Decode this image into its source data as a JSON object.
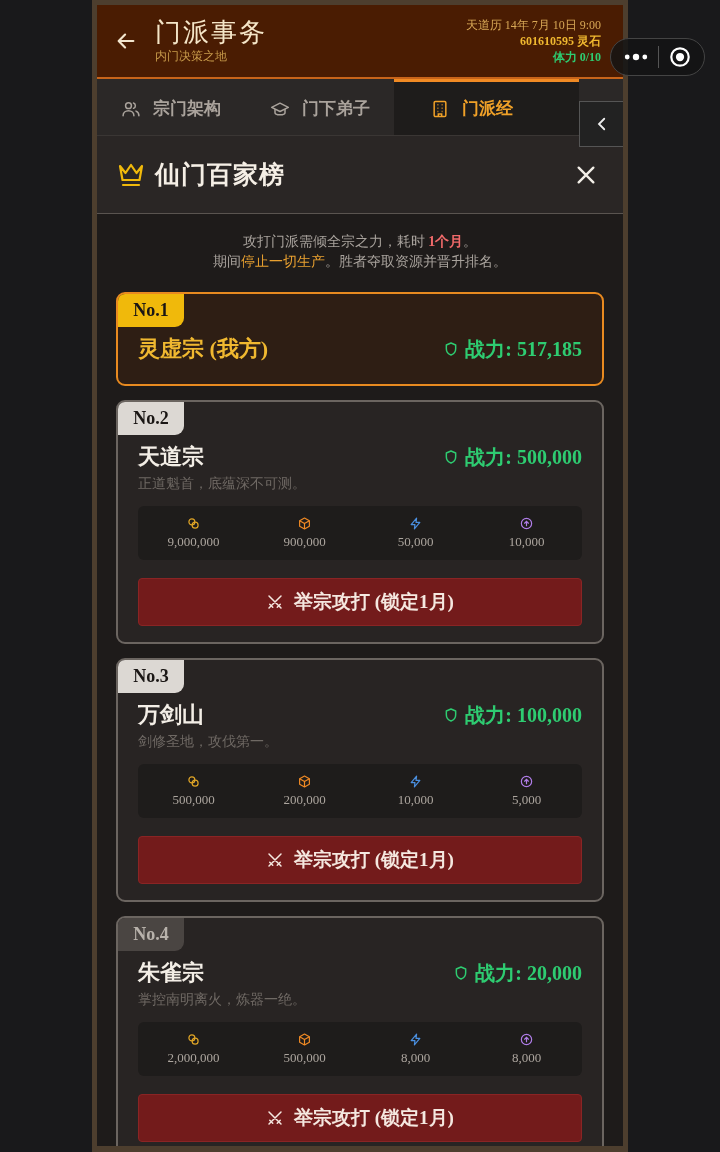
{
  "header": {
    "title": "门派事务",
    "subtitle": "内门决策之地",
    "date": "天道历 14年 7月 10日 9:00",
    "stones": "601610595 灵石",
    "stamina": "体力 0/10"
  },
  "tabs": [
    {
      "label": "宗门架构",
      "selected": false
    },
    {
      "label": "门下弟子",
      "selected": false
    },
    {
      "label": "门派经",
      "selected": true
    }
  ],
  "modal": {
    "title": "仙门百家榜",
    "notice": [
      [
        {
          "text": "攻打门派需倾全宗之力，耗时 "
        },
        {
          "text": "1个月",
          "kind": "danger"
        },
        {
          "text": "。"
        }
      ],
      [
        {
          "text": "期间"
        },
        {
          "text": "停止一切生产",
          "kind": "warn"
        },
        {
          "text": "。胜者夺取资源并晋升排名。"
        }
      ]
    ]
  },
  "sects": [
    {
      "rank": "No.1",
      "color": "#f0b90b",
      "own": true,
      "name": "灵虚宗 (我方)",
      "power": "战力: 517,185"
    },
    {
      "rank": "No.2",
      "color": "#dcd8d3",
      "own": false,
      "name": "天道宗",
      "power": "战力: 500,000",
      "motto": "正道魁首，底蕴深不可测。",
      "resources": [
        {
          "kind": "coins",
          "value": "9,000,000"
        },
        {
          "kind": "box",
          "value": "900,000"
        },
        {
          "kind": "energy",
          "value": "50,000"
        },
        {
          "kind": "upgrade",
          "value": "10,000"
        }
      ],
      "action": "举宗攻打 (锁定1月)"
    },
    {
      "rank": "No.3",
      "color": "#dcd8d3",
      "own": false,
      "name": "万剑山",
      "power": "战力: 100,000",
      "motto": "剑修圣地，攻伐第一。",
      "resources": [
        {
          "kind": "coins",
          "value": "500,000"
        },
        {
          "kind": "box",
          "value": "200,000"
        },
        {
          "kind": "energy",
          "value": "10,000"
        },
        {
          "kind": "upgrade",
          "value": "5,000"
        }
      ],
      "action": "举宗攻打 (锁定1月)"
    },
    {
      "rank": "No.4",
      "color": "#4a4542",
      "own": false,
      "name": "朱雀宗",
      "power": "战力: 20,000",
      "motto": "掌控南明离火，炼器一绝。",
      "resources": [
        {
          "kind": "coins",
          "value": "2,000,000"
        },
        {
          "kind": "box",
          "value": "500,000"
        },
        {
          "kind": "energy",
          "value": "8,000"
        },
        {
          "kind": "upgrade",
          "value": "8,000"
        }
      ],
      "action": "举宗攻打 (锁定1月)"
    }
  ]
}
